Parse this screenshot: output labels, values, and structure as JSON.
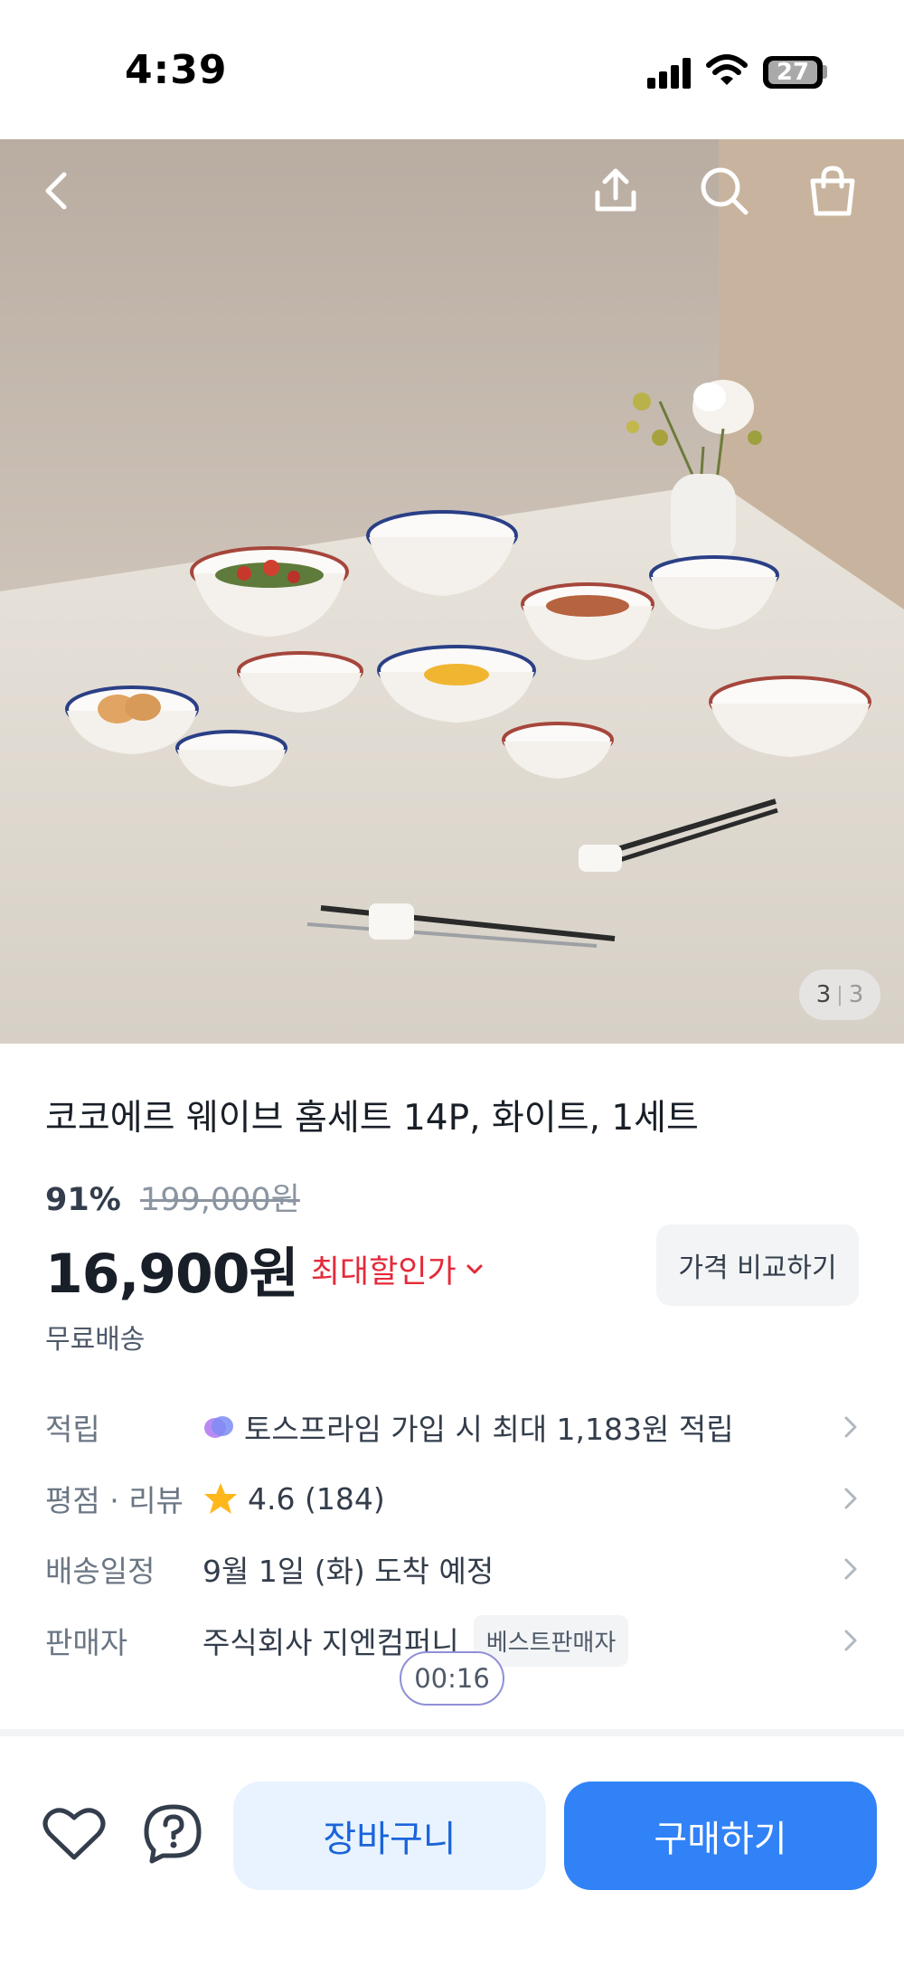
{
  "status_bar": {
    "time": "4:39",
    "battery": "27"
  },
  "top_nav": {
    "icons": [
      "back-arrow-icon",
      "share-icon",
      "search-icon",
      "shopping-bag-icon"
    ]
  },
  "gallery": {
    "current": "3",
    "total": "3"
  },
  "product": {
    "title": "코코에르 웨이브 홈세트 14P, 화이트, 1세트",
    "discount_rate": "91%",
    "original_price": "199,000원",
    "price": "16,900원",
    "max_discount_label": "최대할인가",
    "compare_label": "가격 비교하기",
    "shipping": "무료배송"
  },
  "info": {
    "points_label": "적립",
    "points_value": "토스프라임 가입 시 최대 1,183원 적립",
    "rating_label": "평점 · 리뷰",
    "rating_value": "4.6 (184)",
    "delivery_label": "배송일정",
    "delivery_value": "9월 1일 (화) 도착 예정",
    "seller_label": "판매자",
    "seller_value": "주식회사 지엔컴퍼니",
    "seller_badge": "베스트판매자"
  },
  "timer": "00:16",
  "actions": {
    "cart_label": "장바구니",
    "buy_label": "구매하기"
  },
  "colors": {
    "accent": "#3182f6",
    "accent_light": "#e8f3ff",
    "discount_red": "#e42939",
    "star": "#ffb71c"
  }
}
